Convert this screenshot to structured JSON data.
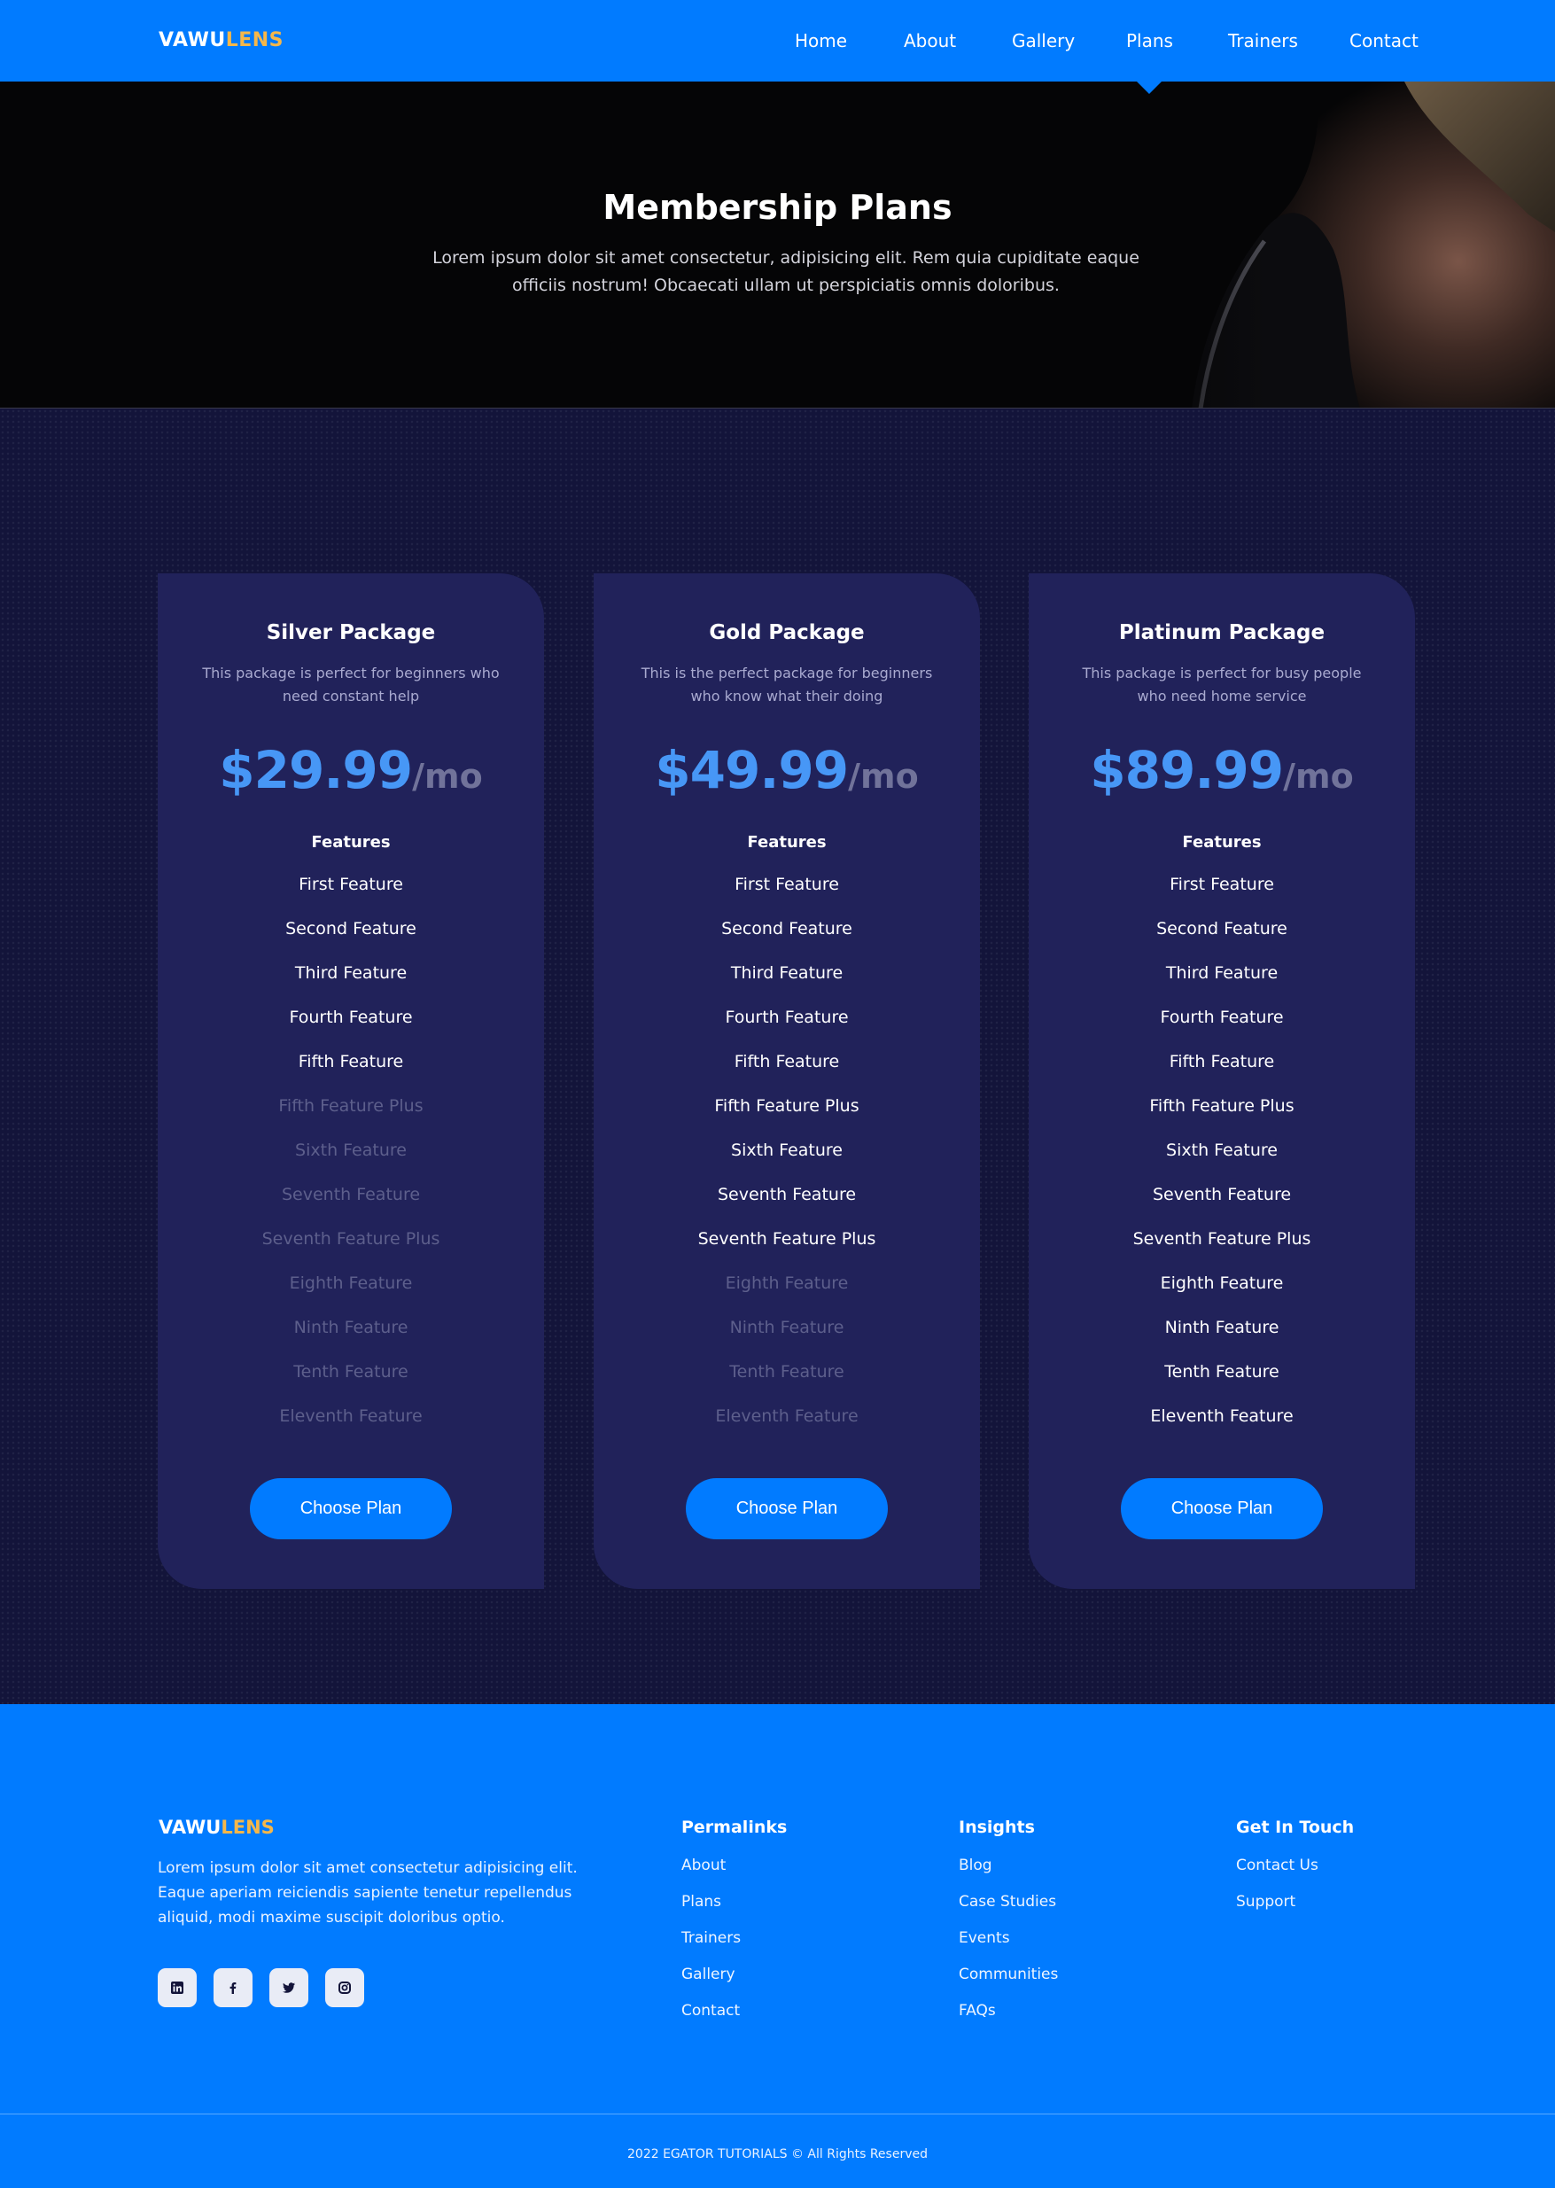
{
  "brand": {
    "name_part1": "VAWU",
    "name_part2": "LENS",
    "accent_color": "#f5b74a"
  },
  "nav": {
    "items": [
      {
        "label": "Home"
      },
      {
        "label": "About"
      },
      {
        "label": "Gallery"
      },
      {
        "label": "Plans",
        "active": true
      },
      {
        "label": "Trainers"
      },
      {
        "label": "Contact"
      }
    ]
  },
  "hero": {
    "title": "Membership Plans",
    "text": "Lorem ipsum dolor sit amet consectetur, adipisicing elit. Rem quia cupiditate eaque officiis nostrum! Obcaecati ullam ut perspiciatis omnis doloribus."
  },
  "plans": [
    {
      "title": "Silver Package",
      "description": "This package is perfect for beginners who need constant help",
      "price": "$29.99",
      "period": "/mo",
      "features_heading": "Features",
      "features": [
        {
          "label": "First Feature",
          "included": true
        },
        {
          "label": "Second Feature",
          "included": true
        },
        {
          "label": "Third Feature",
          "included": true
        },
        {
          "label": "Fourth Feature",
          "included": true
        },
        {
          "label": "Fifth Feature",
          "included": true
        },
        {
          "label": "Fifth Feature Plus",
          "included": false
        },
        {
          "label": "Sixth Feature",
          "included": false
        },
        {
          "label": "Seventh Feature",
          "included": false
        },
        {
          "label": "Seventh Feature Plus",
          "included": false
        },
        {
          "label": "Eighth Feature",
          "included": false
        },
        {
          "label": "Ninth Feature",
          "included": false
        },
        {
          "label": "Tenth Feature",
          "included": false
        },
        {
          "label": "Eleventh Feature",
          "included": false
        }
      ],
      "button_label": "Choose Plan"
    },
    {
      "title": "Gold Package",
      "description": "This is the perfect package for beginners who know what their doing",
      "price": "$49.99",
      "period": "/mo",
      "features_heading": "Features",
      "features": [
        {
          "label": "First Feature",
          "included": true
        },
        {
          "label": "Second Feature",
          "included": true
        },
        {
          "label": "Third Feature",
          "included": true
        },
        {
          "label": "Fourth Feature",
          "included": true
        },
        {
          "label": "Fifth Feature",
          "included": true
        },
        {
          "label": "Fifth Feature Plus",
          "included": true
        },
        {
          "label": "Sixth Feature",
          "included": true
        },
        {
          "label": "Seventh Feature",
          "included": true
        },
        {
          "label": "Seventh Feature Plus",
          "included": true
        },
        {
          "label": "Eighth Feature",
          "included": false
        },
        {
          "label": "Ninth Feature",
          "included": false
        },
        {
          "label": "Tenth Feature",
          "included": false
        },
        {
          "label": "Eleventh Feature",
          "included": false
        }
      ],
      "button_label": "Choose Plan"
    },
    {
      "title": "Platinum Package",
      "description": "This package is perfect for busy people who need home service",
      "price": "$89.99",
      "period": "/mo",
      "features_heading": "Features",
      "features": [
        {
          "label": "First Feature",
          "included": true
        },
        {
          "label": "Second Feature",
          "included": true
        },
        {
          "label": "Third Feature",
          "included": true
        },
        {
          "label": "Fourth Feature",
          "included": true
        },
        {
          "label": "Fifth Feature",
          "included": true
        },
        {
          "label": "Fifth Feature Plus",
          "included": true
        },
        {
          "label": "Sixth Feature",
          "included": true
        },
        {
          "label": "Seventh Feature",
          "included": true
        },
        {
          "label": "Seventh Feature Plus",
          "included": true
        },
        {
          "label": "Eighth Feature",
          "included": true
        },
        {
          "label": "Ninth Feature",
          "included": true
        },
        {
          "label": "Tenth Feature",
          "included": true
        },
        {
          "label": "Eleventh Feature",
          "included": true
        }
      ],
      "button_label": "Choose Plan"
    }
  ],
  "footer": {
    "about": "Lorem ipsum dolor sit amet consectetur adipisicing elit. Eaque aperiam reiciendis sapiente tenetur repellendus aliquid, modi maxime suscipit doloribus optio.",
    "socials": [
      {
        "icon": "linkedin-icon"
      },
      {
        "icon": "facebook-icon"
      },
      {
        "icon": "twitter-icon"
      },
      {
        "icon": "instagram-icon"
      }
    ],
    "columns": [
      {
        "heading": "Permalinks",
        "links": [
          "About",
          "Plans",
          "Trainers",
          "Gallery",
          "Contact"
        ]
      },
      {
        "heading": "Insights",
        "links": [
          "Blog",
          "Case Studies",
          "Events",
          "Communities",
          "FAQs"
        ]
      },
      {
        "heading": "Get In Touch",
        "links": [
          "Contact Us",
          "Support"
        ]
      }
    ],
    "copyright": "2022 EGATOR TUTORIALS © All Rights Reserved"
  },
  "colors": {
    "primary": "#017bff",
    "card_bg": "#21225a",
    "page_bg": "#13143a",
    "price": "#4797f6"
  }
}
